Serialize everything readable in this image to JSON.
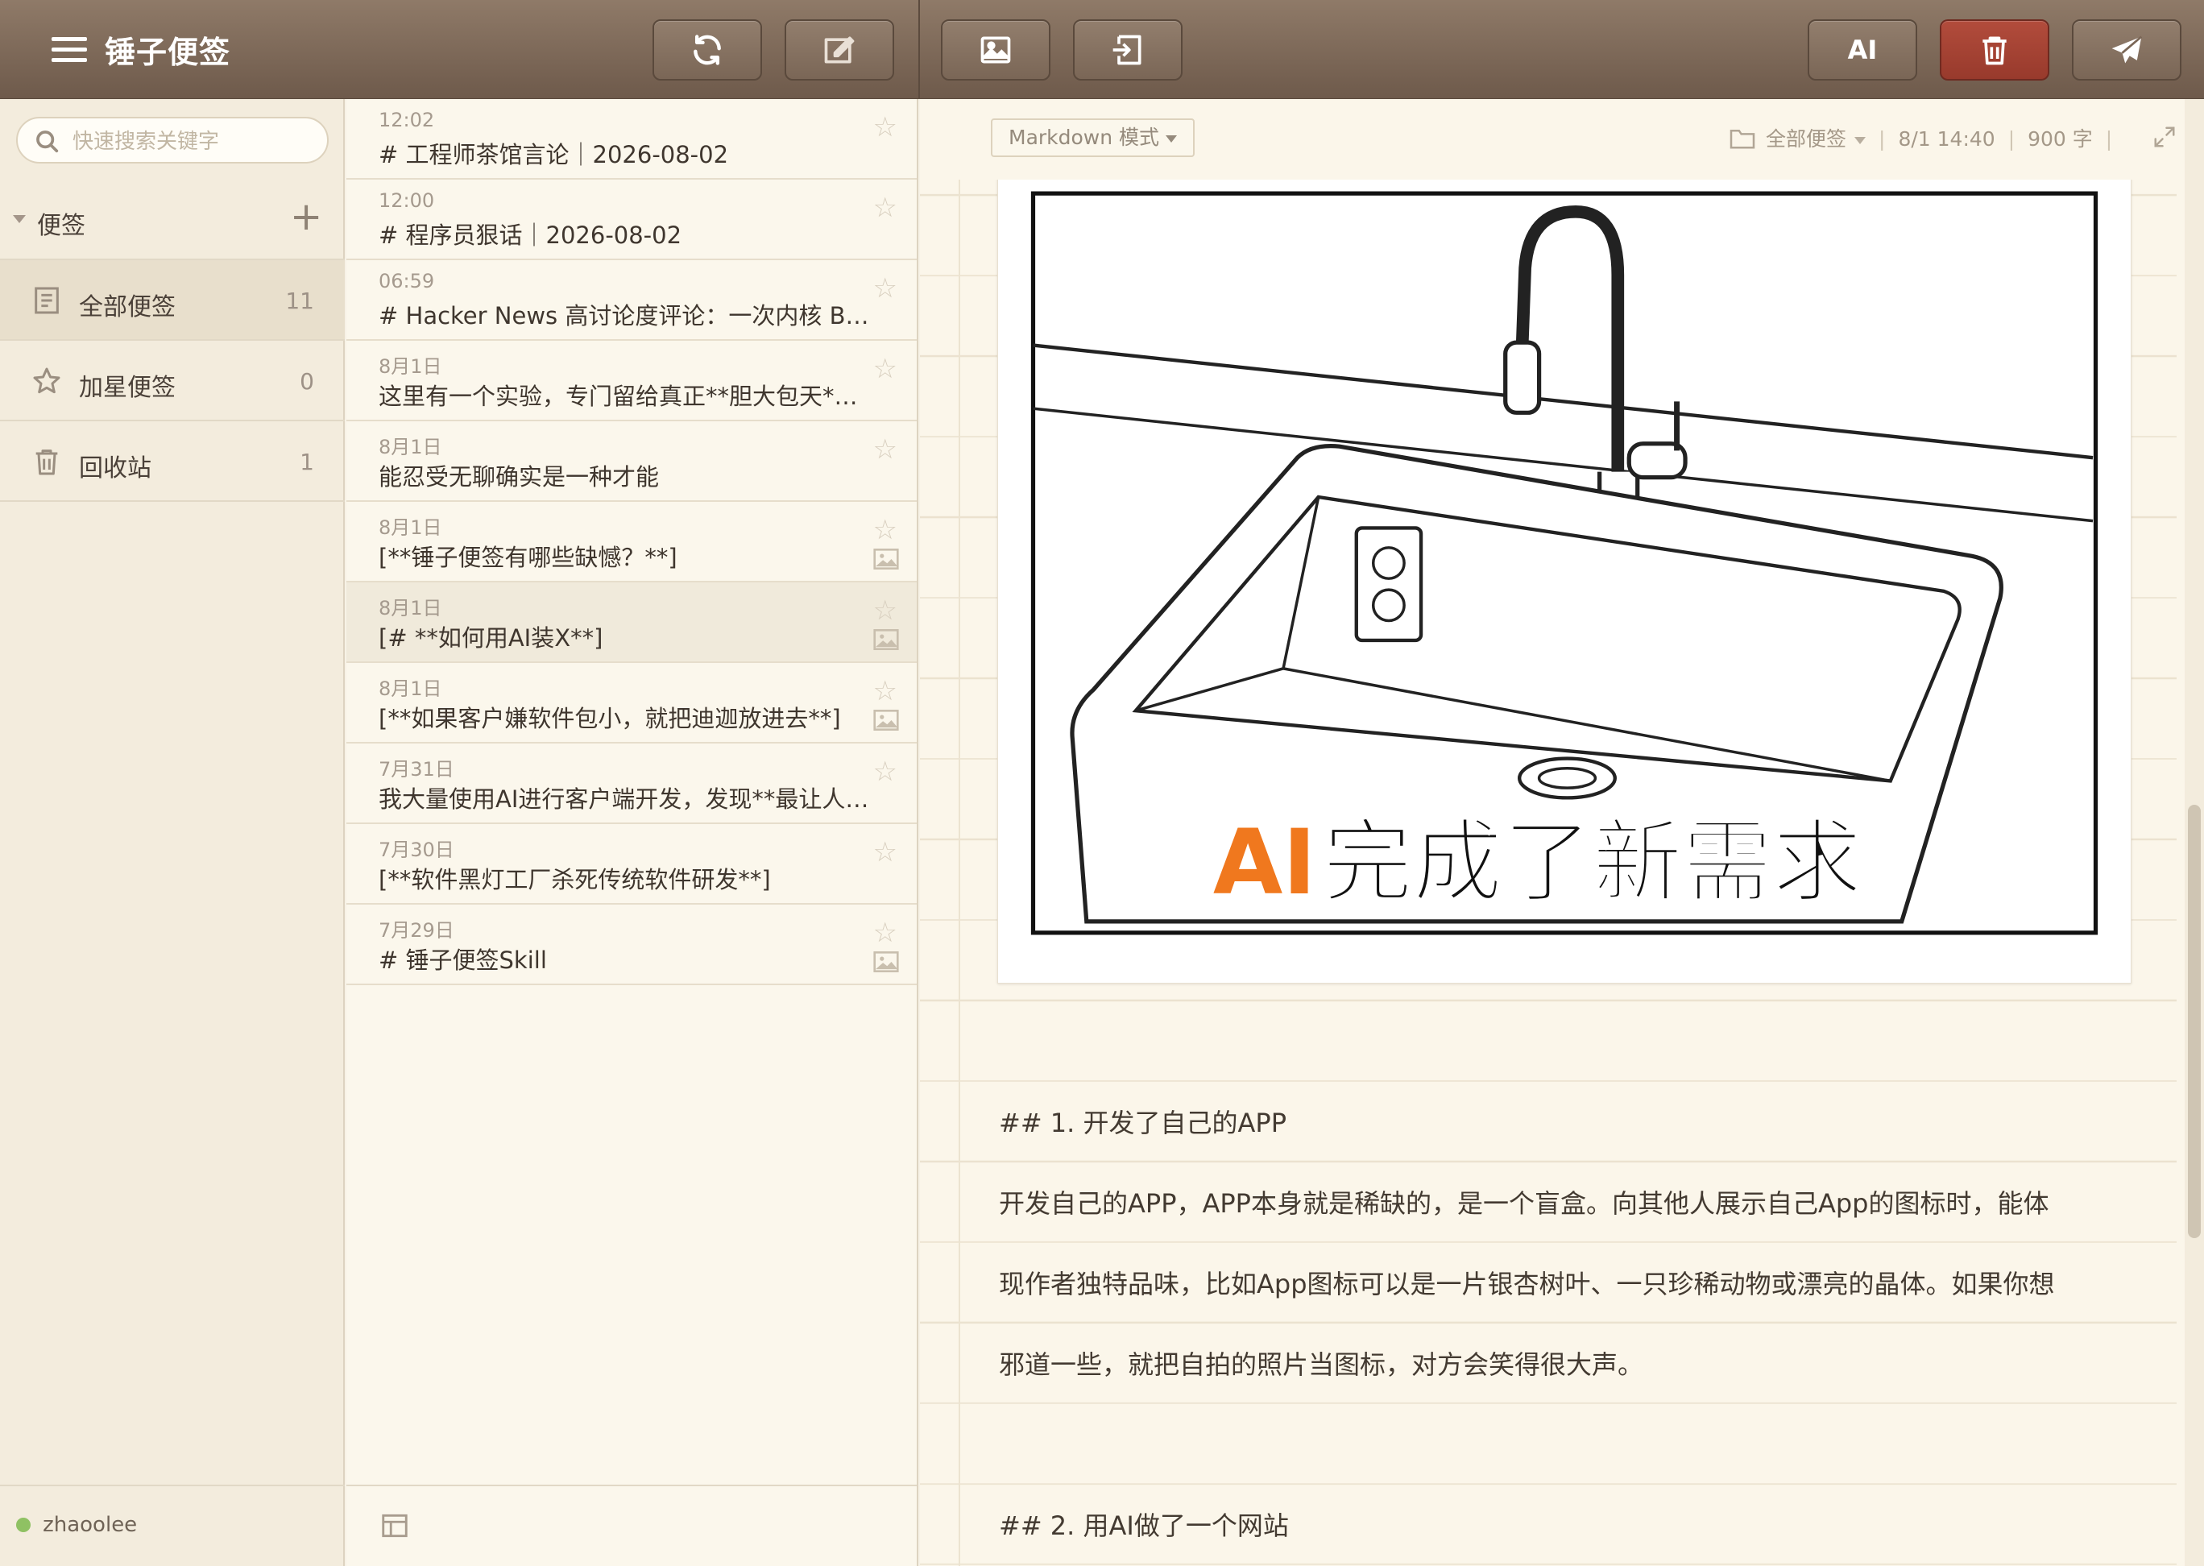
{
  "app": {
    "title": "锤子便签"
  },
  "toolbar": {
    "ai_label": "AI",
    "buttons": [
      "sync-icon",
      "compose-icon",
      "image-icon",
      "import-icon",
      "trash-icon",
      "send-icon"
    ]
  },
  "sidebar": {
    "search_placeholder": "快速搜索关键字",
    "section_label": "便签",
    "items": [
      {
        "label": "全部便签",
        "count": "11",
        "icon": "note-icon"
      },
      {
        "label": "加星便签",
        "count": "0",
        "icon": "star-icon"
      },
      {
        "label": "回收站",
        "count": "1",
        "icon": "trash-icon"
      }
    ],
    "user": "zhaoolee"
  },
  "notes": [
    {
      "time": "12:02",
      "title": "# 工程师茶馆言论｜2026-08-02",
      "has_image": false
    },
    {
      "time": "12:00",
      "title": "# 程序员狠话｜2026-08-02",
      "has_image": false
    },
    {
      "time": "06:59",
      "title": "# Hacker News 高讨论度评论：一次内核 Bu…",
      "has_image": false
    },
    {
      "time": "8月1日",
      "title": "这里有一个实验，专门留给真正**胆大包天*…",
      "has_image": false
    },
    {
      "time": "8月1日",
      "title": "能忍受无聊确实是一种才能",
      "has_image": false
    },
    {
      "time": "8月1日",
      "title": "[**锤子便签有哪些缺憾？**]",
      "has_image": true
    },
    {
      "time": "8月1日",
      "title": "[# **如何用AI装X**]",
      "has_image": true,
      "selected": true
    },
    {
      "time": "8月1日",
      "title": "[**如果客户嫌软件包小，就把迪迦放进去**]",
      "has_image": true
    },
    {
      "time": "7月31日",
      "title": "我大量使用AI进行客户端开发，发现**最让人…",
      "has_image": false
    },
    {
      "time": "7月30日",
      "title": "[**软件黑灯工厂杀死传统软件研发**]",
      "has_image": false
    },
    {
      "time": "7月29日",
      "title": "# 锤子便签Skill",
      "has_image": true
    }
  ],
  "editor": {
    "mode": "Markdown 模式",
    "folder": "全部便签",
    "datetime": "8/1 14:40",
    "word_count": "900 字",
    "image_caption_ai": "AI",
    "image_caption_rest": "完成了新需求",
    "lines": [
      "## 1. 开发了自己的APP",
      "开发自己的APP，APP本身就是稀缺的，是一个盲盒。向其他人展示自己App的图标时，能体",
      "现作者独特品味，比如App图标可以是一片银杏树叶、一只珍稀动物或漂亮的晶体。如果你想",
      "邪道一些，就把自拍的照片当图标，对方会笑得很大声。",
      "## 2. 用AI做了一个网站"
    ]
  },
  "colors": {
    "accent_delete": "#b24c3c",
    "caption_ai": "#f0781e",
    "online": "#8fc163"
  }
}
